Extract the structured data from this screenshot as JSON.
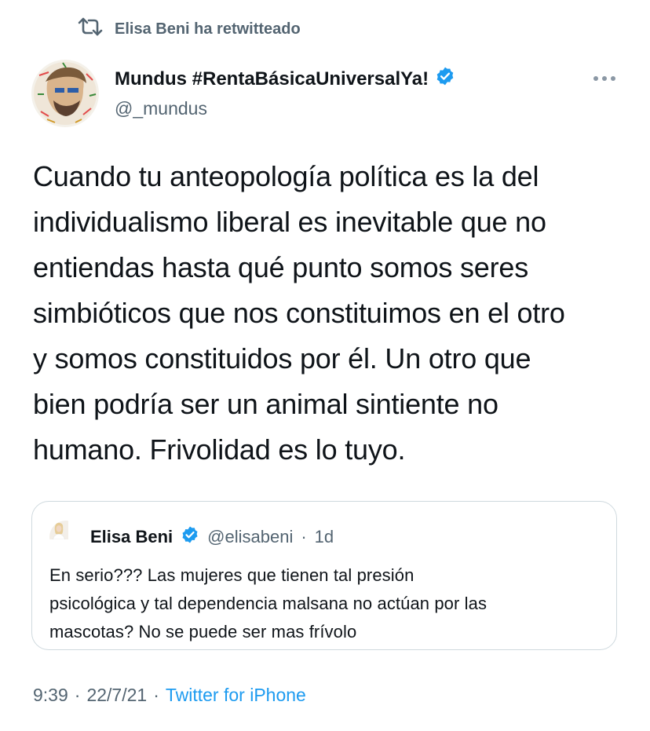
{
  "retweet": {
    "icon": "retweet-icon",
    "label": "Elisa Beni ha retwitteado"
  },
  "author": {
    "name": "Mundus #RentaBásicaUniversalYa!",
    "handle": "@_mundus",
    "verified_icon": "verified-badge-icon"
  },
  "more_icon": "more-options-icon",
  "tweet": {
    "lines": [
      "Cuando tu anteopología política es la del",
      "individualismo liberal es inevitable que no",
      "entiendas hasta qué punto somos seres",
      "simbióticos que nos constituimos en el otro",
      "y somos constituidos por él. Un otro que",
      "bien podría ser un animal sintiente no",
      "humano. Frivolidad es lo tuyo."
    ]
  },
  "quote": {
    "name": "Elisa Beni",
    "handle": "@elisabeni",
    "separator": "·",
    "time": "1d",
    "lines": [
      "En serio??? Las mujeres que tienen tal presión",
      "psicológica y tal dependencia malsana no actúan por las",
      "mascotas? No se puede ser mas frívolo"
    ]
  },
  "meta": {
    "time": "9:39",
    "dot1": "·",
    "date": "22/7/21",
    "dot2": "·",
    "source": "Twitter for iPhone"
  },
  "colors": {
    "blue": "#1d9bf0",
    "gray": "#536471",
    "text": "#0f1419",
    "border": "#cfd9de"
  }
}
